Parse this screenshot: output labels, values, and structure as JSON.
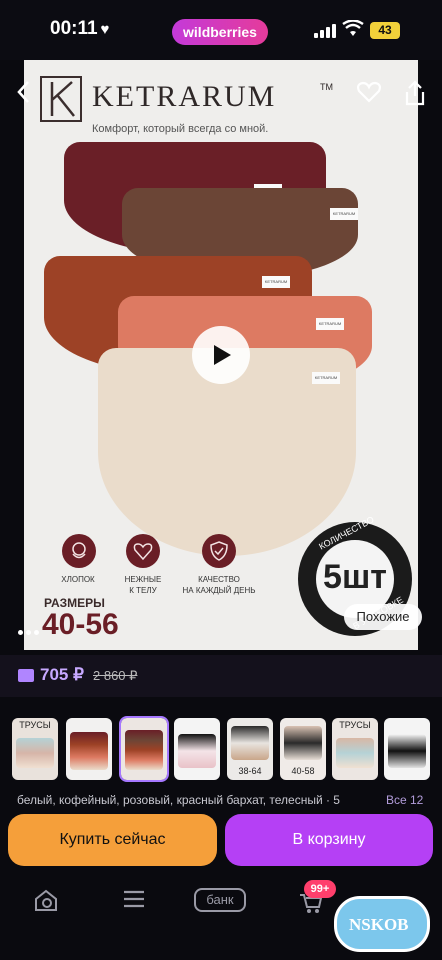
{
  "status_bar": {
    "time": "00:11",
    "heart": "♥",
    "app_pill": "wildberries",
    "battery": "43"
  },
  "product": {
    "brand": "KETRARUM",
    "tm": "TM",
    "slogan": "Комфорт, который всегда со мной.",
    "tag_text": "KETRARUM",
    "features": [
      "ХЛОПОК",
      "НЕЖНЫЕ\nК ТЕЛУ",
      "КАЧЕСТВО\nНА КАЖДЫЙ ДЕНЬ"
    ],
    "sizes_label": "РАЗМЕРЫ",
    "sizes_value": "40-56",
    "qty_top": "КОЛИЧЕСТВО",
    "qty_value": "5шт",
    "qty_bottom": "В УПАКОВКЕ",
    "similar_label": "Похожие"
  },
  "price": {
    "current": "705 ₽",
    "old": "2 860 ₽"
  },
  "thumbnails": [
    {
      "label": "ТРУСЫ"
    },
    {
      "label": ""
    },
    {
      "label": ""
    },
    {
      "label": ""
    },
    {
      "label": "38-64"
    },
    {
      "label": "40-58"
    },
    {
      "label": "ТРУСЫ"
    },
    {
      "label": ""
    }
  ],
  "colors_text": "белый, кофейный, розовый, красный бархат, телесный · 5",
  "see_all": "Все 12",
  "buttons": {
    "buy_now": "Купить сейчас",
    "to_cart": "В корзину"
  },
  "tabbar": {
    "bank": "банк",
    "cart_count": "99+"
  },
  "watermark": "NSKOB",
  "colors": {
    "accent": "#b540f5",
    "buy": "#f59f3a",
    "price": "#c7a9ff",
    "brand_wine": "#6a1e26"
  }
}
